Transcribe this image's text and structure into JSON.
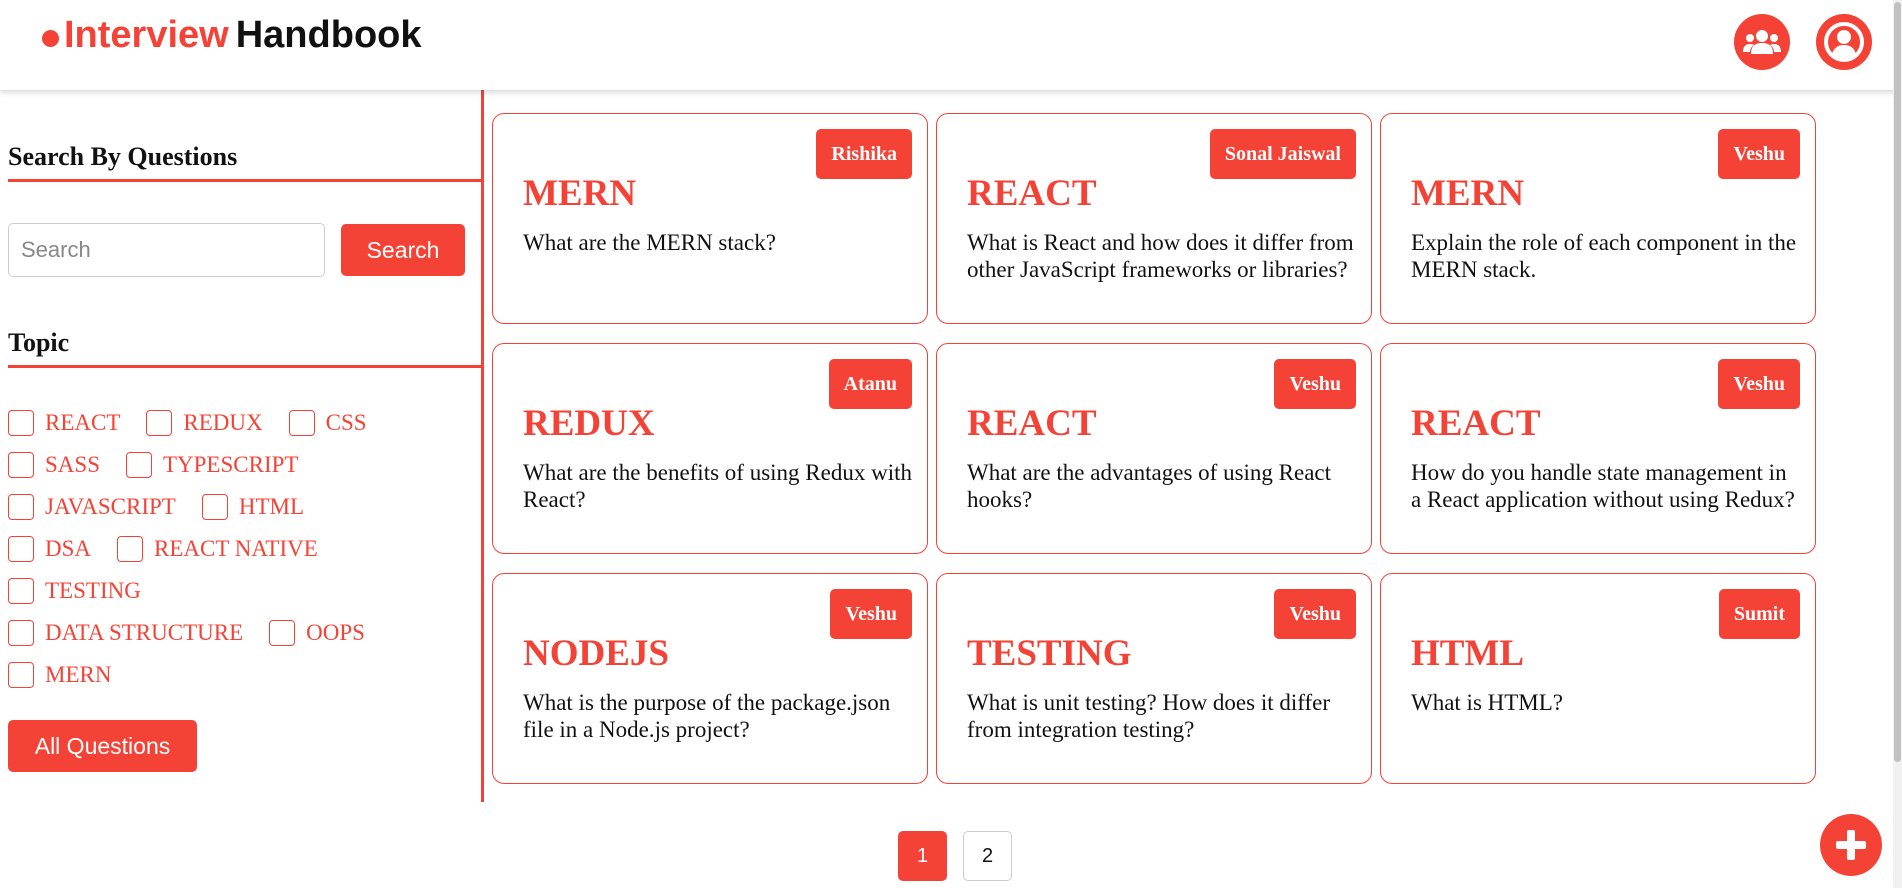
{
  "header": {
    "logo_part1": "Interview",
    "logo_part2": "Handbook",
    "users_icon": "users-icon",
    "profile_icon": "user-circle-icon"
  },
  "sidebar": {
    "search_title": "Search By Questions",
    "search_placeholder": "Search",
    "search_value": "",
    "search_button": "Search",
    "topic_title": "Topic",
    "topics": [
      "REACT",
      "REDUX",
      "CSS",
      "SASS",
      "TYPESCRIPT",
      "JAVASCRIPT",
      "HTML",
      "DSA",
      "REACT NATIVE",
      "TESTING",
      "DATA STRUCTURE",
      "OOPS",
      "MERN"
    ],
    "all_questions_button": "All Questions"
  },
  "cards": [
    {
      "author": "Rishika",
      "topic": "MERN",
      "question": "What are the MERN stack?"
    },
    {
      "author": "Sonal Jaiswal",
      "topic": "REACT",
      "question": "What is React and how does it differ from other JavaScript frameworks or libraries?"
    },
    {
      "author": "Veshu",
      "topic": "MERN",
      "question": "Explain the role of each component in the MERN stack."
    },
    {
      "author": "Atanu",
      "topic": "REDUX",
      "question": "What are the benefits of using Redux with React?"
    },
    {
      "author": "Veshu",
      "topic": "REACT",
      "question": "What are the advantages of using React hooks?"
    },
    {
      "author": "Veshu",
      "topic": "REACT",
      "question": "How do you handle state management in a React application without using Redux?"
    },
    {
      "author": "Veshu",
      "topic": "NODEJS",
      "question": "What is the purpose of the package.json file in a Node.js project?"
    },
    {
      "author": "Veshu",
      "topic": "TESTING",
      "question": "What is unit testing? How does it differ from integration testing?"
    },
    {
      "author": "Sumit",
      "topic": "HTML",
      "question": "What is HTML?"
    }
  ],
  "pagination": {
    "pages": [
      "1",
      "2"
    ],
    "current": "1"
  },
  "fab_icon": "plus-icon",
  "colors": {
    "accent": "#f44336",
    "text": "#111111",
    "background": "#ffffff"
  }
}
